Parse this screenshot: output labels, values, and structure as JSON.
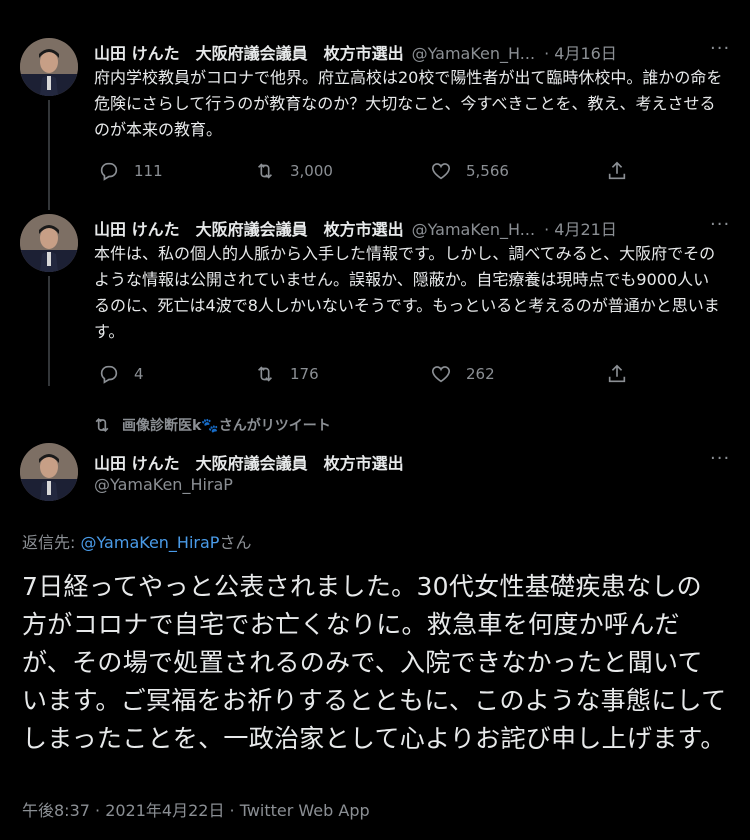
{
  "tweets": [
    {
      "name": "山田 けんた　大阪府議会議員　枚方市選出",
      "handle": "@YamaKen_H...",
      "date": "· 4月16日",
      "text": "府内学校教員がコロナで他界。府立高校は20校で陽性者が出て臨時休校中。誰かの命を危険にさらして行うのが教育なのか？大切なこと、今すべきことを、教え、考えさせるのが本来の教育。",
      "replies": "111",
      "retweets": "3,000",
      "likes": "5,566"
    },
    {
      "name": "山田 けんた　大阪府議会議員　枚方市選出",
      "handle": "@YamaKen_H...",
      "date": "· 4月21日",
      "text": "本件は、私の個人的人脈から入手した情報です。しかし、調べてみると、大阪府でそのような情報は公開されていません。誤報か、隠蔽か。自宅療養は現時点でも9000人いるのに、死亡は4波で8人しかいないそうです。もっといると考えるのが普通かと思います。",
      "replies": "4",
      "retweets": "176",
      "likes": "262"
    }
  ],
  "retweet_note": "画像診断医k🐾さんがリツイート",
  "main": {
    "name": "山田 けんた　大阪府議会議員　枚方市選出",
    "handle": "@YamaKen_HiraP",
    "reply_prefix": "返信先: ",
    "reply_handle": "@YamaKen_HiraP",
    "reply_suffix": "さん",
    "text": "7日経ってやっと公表されました。30代女性基礎疾患なしの方がコロナで自宅でお亡くなりに。救急車を何度か呼んだが、その場で処置されるのみで、入院できなかったと聞いています。ご冥福をお祈りするとともに、このような事態にしてしまったことを、一政治家として心よりお詫び申し上げます。",
    "meta": "午後8:37 · 2021年4月22日 · Twitter Web App"
  },
  "more_symbol": "···",
  "icons": [
    "reply-icon",
    "retweet-icon",
    "like-icon",
    "share-icon",
    "more-icon",
    "avatar"
  ],
  "colors": {
    "background": "#000000",
    "text": "#e7e9ea",
    "secondary": "#8b8f94",
    "link": "#4a9be8"
  }
}
